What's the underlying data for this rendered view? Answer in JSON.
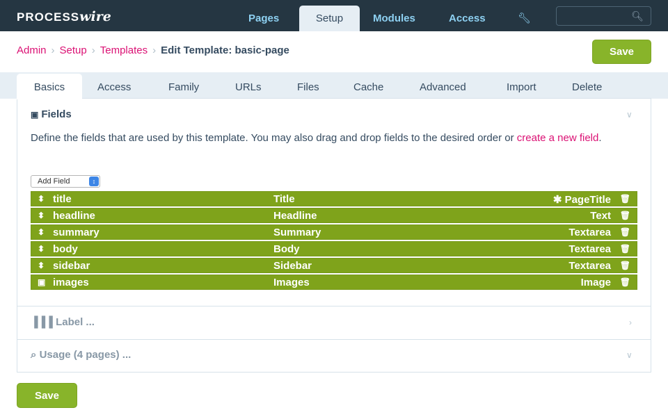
{
  "masthead": {
    "logo_a": "PROCESS",
    "logo_b": "wire",
    "nav": [
      "Pages",
      "Setup",
      "Modules",
      "Access"
    ],
    "active_nav": "Setup",
    "search_placeholder": ""
  },
  "breadcrumb": {
    "items": [
      "Admin",
      "Setup",
      "Templates"
    ],
    "separator": "›",
    "current": "Edit Template: basic-page"
  },
  "buttons": {
    "save_label": "Save"
  },
  "tabs": [
    "Basics",
    "Access",
    "Family",
    "URLs",
    "Files",
    "Cache",
    "Advanced",
    "Import",
    "Delete"
  ],
  "fields_section": {
    "title": "Fields",
    "description": "Define the fields that are used by this template. You may also drag and drop fields to the desired order or ",
    "link_text": "create a new field",
    "link_suffix": ".",
    "add_field_label": "Add Field",
    "rows": [
      {
        "name": "title",
        "label": "Title",
        "type": "✱ PageTitle",
        "icon": "drag-handle-icon"
      },
      {
        "name": "headline",
        "label": "Headline",
        "type": "Text",
        "icon": "drag-handle-icon"
      },
      {
        "name": "summary",
        "label": "Summary",
        "type": "Textarea",
        "icon": "drag-handle-icon"
      },
      {
        "name": "body",
        "label": "Body",
        "type": "Textarea",
        "icon": "drag-handle-icon"
      },
      {
        "name": "sidebar",
        "label": "Sidebar",
        "type": "Textarea",
        "icon": "drag-handle-icon"
      },
      {
        "name": "images",
        "label": "Images",
        "type": "Image",
        "icon": "camera-icon"
      }
    ]
  },
  "label_section": {
    "title": "Label ..."
  },
  "usage_section": {
    "title": "Usage (4 pages) ..."
  },
  "colors": {
    "accent": "#88b42a",
    "link": "#db1174",
    "masthead": "#253642",
    "row": "#7fa31b"
  }
}
